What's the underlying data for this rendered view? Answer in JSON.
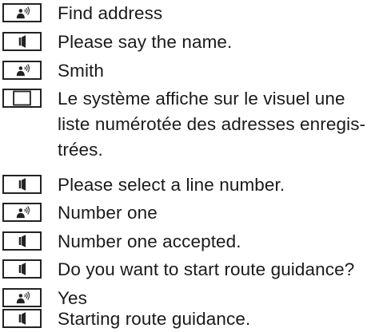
{
  "dialog": {
    "rows": [
      {
        "icon": "user-speaks-icon",
        "text": "Find address"
      },
      {
        "icon": "speaker-icon",
        "text": "Please say the name."
      },
      {
        "icon": "user-speaks-icon",
        "text": "Smith"
      },
      {
        "icon": "display-icon",
        "text": "Le système affiche sur le visuel une liste numérotée des adresses enregis-trées."
      },
      {
        "icon": "speaker-icon",
        "text": "Please select a line number."
      },
      {
        "icon": "user-speaks-icon",
        "text": "Number one"
      },
      {
        "icon": "speaker-icon",
        "text": "Number one accepted."
      },
      {
        "icon": "speaker-icon",
        "text": "Do you want to start route guidance?"
      },
      {
        "icon": "user-speaks-icon",
        "text": "Yes"
      },
      {
        "icon": "speaker-icon",
        "text": "Starting route guidance."
      }
    ]
  }
}
